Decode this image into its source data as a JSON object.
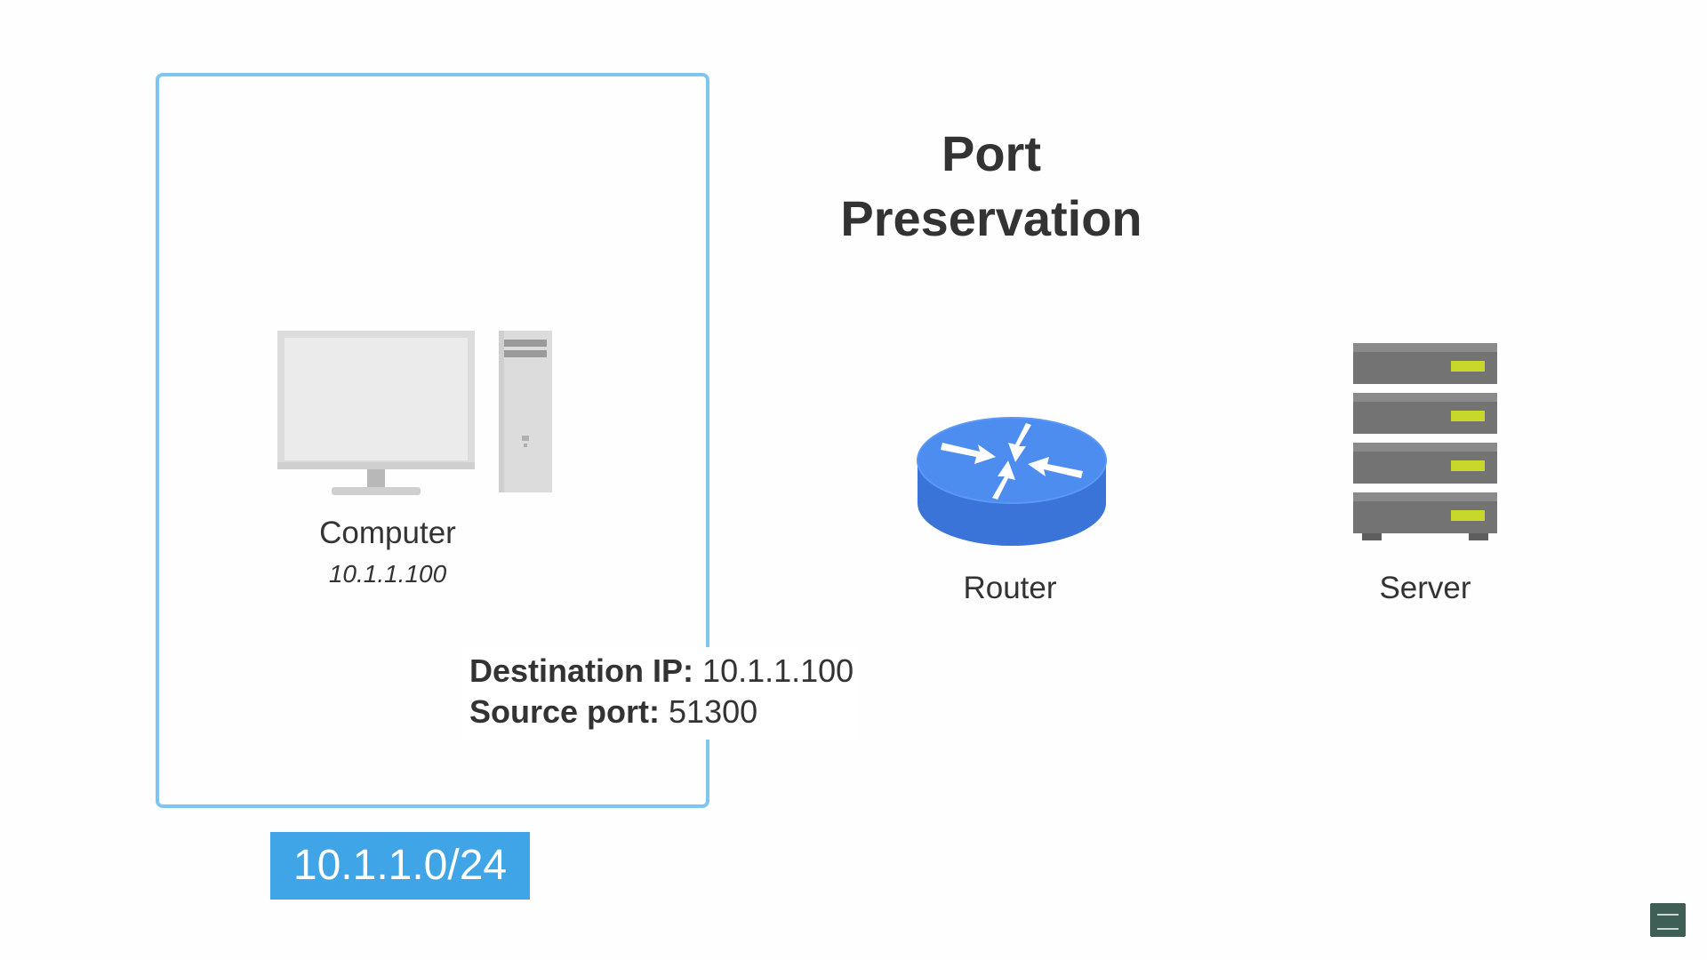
{
  "title": {
    "line1": "Port",
    "line2": "Preservation"
  },
  "subnet": {
    "label": "10.1.1.0/24",
    "border_color": "#7ec6f0",
    "label_bg": "#3fa5e6"
  },
  "computer": {
    "label": "Computer",
    "ip": "10.1.1.100",
    "icon": "desktop-computer-icon"
  },
  "router": {
    "label": "Router",
    "icon": "router-icon",
    "color": "#3e7fe0"
  },
  "server": {
    "label": "Server",
    "icon": "server-rack-icon",
    "led_color": "#c8d82a"
  },
  "packet": {
    "dest_key": "Destination IP:",
    "dest_value": "10.1.1.100",
    "port_key": "Source port:",
    "port_value": "51300"
  }
}
